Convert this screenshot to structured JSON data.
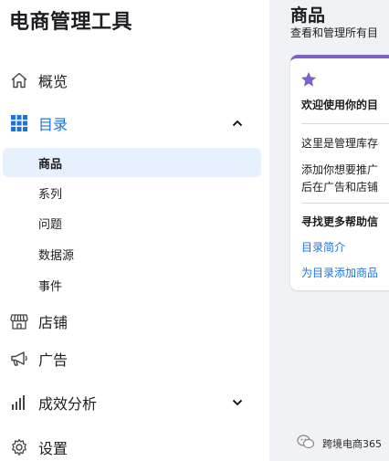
{
  "app": {
    "title": "电商管理工具"
  },
  "sidebar": {
    "items": [
      {
        "label": "概览",
        "icon": "home-icon"
      },
      {
        "label": "目录",
        "icon": "grid-icon",
        "expanded": true
      },
      {
        "label": "店铺",
        "icon": "storefront-icon"
      },
      {
        "label": "广告",
        "icon": "megaphone-icon"
      },
      {
        "label": "成效分析",
        "icon": "bar-chart-icon",
        "expanded": false
      },
      {
        "label": "设置",
        "icon": "gear-icon"
      }
    ],
    "catalog_subitems": [
      {
        "label": "商品",
        "selected": true
      },
      {
        "label": "系列"
      },
      {
        "label": "问题"
      },
      {
        "label": "数据源"
      },
      {
        "label": "事件"
      }
    ]
  },
  "main": {
    "title": "商品",
    "subtitle": "查看和管理所有目",
    "card": {
      "icon": "star-icon",
      "welcome": "欢迎使用你的目",
      "line1": "这里是管理库存",
      "line2a": "添加你想要推广",
      "line2b": "后在广告和店铺",
      "help_title": "寻找更多帮助信",
      "link1": "目录简介",
      "link2": "为目录添加商品"
    }
  },
  "watermark": {
    "text": "跨境电商365"
  },
  "colors": {
    "accent": "#1b74e4",
    "selected_bg": "#e7f0fd",
    "card_top": "#7b61c9",
    "main_bg": "#f0f2f5"
  }
}
